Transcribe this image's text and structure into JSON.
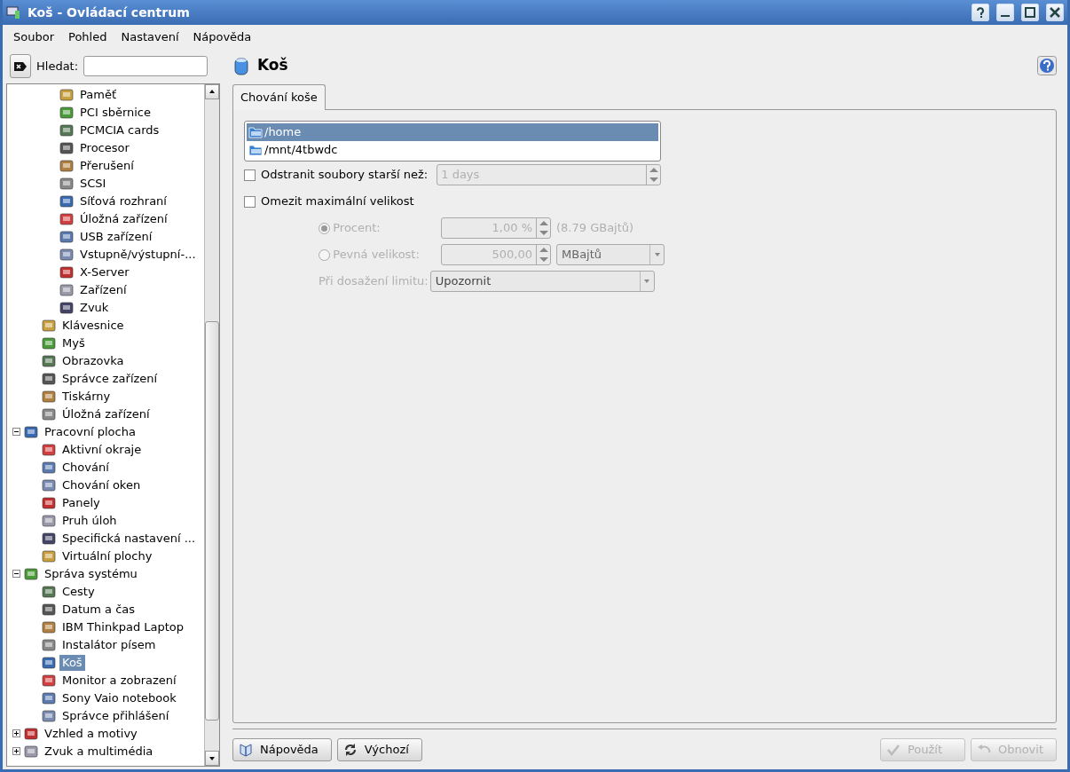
{
  "window": {
    "title": "Koš - Ovládací centrum"
  },
  "menu": [
    "Soubor",
    "Pohled",
    "Nastavení",
    "Nápověda"
  ],
  "search": {
    "label": "Hledat:"
  },
  "tree": [
    {
      "children": [
        {
          "children": [
            {
              "label": "Paměť",
              "selected": false
            },
            {
              "label": "PCI sběrnice",
              "selected": false
            },
            {
              "label": "PCMCIA cards",
              "selected": false
            },
            {
              "label": "Procesor",
              "selected": false
            },
            {
              "label": "Přerušení",
              "selected": false
            },
            {
              "label": "SCSI",
              "selected": false
            },
            {
              "label": "Síťová rozhraní",
              "selected": false
            },
            {
              "label": "Úložná zařízení",
              "selected": false
            },
            {
              "label": "USB zařízení",
              "selected": false
            },
            {
              "label": "Vstupně/výstupní-...",
              "selected": false
            },
            {
              "label": "X-Server",
              "selected": false
            },
            {
              "label": "Zařízení",
              "selected": false
            },
            {
              "label": "Zvuk",
              "selected": false
            }
          ]
        },
        {
          "label": "Klávesnice",
          "selected": false
        },
        {
          "label": "Myš",
          "selected": false
        },
        {
          "label": "Obrazovka",
          "selected": false
        },
        {
          "label": "Správce zařízení",
          "selected": false
        },
        {
          "label": "Tiskárny",
          "selected": false
        },
        {
          "label": "Úložná zařízení",
          "selected": false
        }
      ]
    },
    {
      "label": "Pracovní plocha",
      "selected": false,
      "expanded": true,
      "children": [
        {
          "label": "Aktivní okraje",
          "selected": false
        },
        {
          "label": "Chování",
          "selected": false
        },
        {
          "label": "Chování oken",
          "selected": false
        },
        {
          "label": "Panely",
          "selected": false
        },
        {
          "label": "Pruh úloh",
          "selected": false
        },
        {
          "label": "Specifická nastavení ...",
          "selected": false
        },
        {
          "label": "Virtuální plochy",
          "selected": false
        }
      ]
    },
    {
      "label": "Správa systému",
      "selected": false,
      "expanded": true,
      "children": [
        {
          "label": "Cesty",
          "selected": false
        },
        {
          "label": "Datum a čas",
          "selected": false
        },
        {
          "label": "IBM Thinkpad Laptop",
          "selected": false
        },
        {
          "label": "Instalátor písem",
          "selected": false
        },
        {
          "label": "Koš",
          "selected": true
        },
        {
          "label": "Monitor a zobrazení",
          "selected": false
        },
        {
          "label": "Sony Vaio notebook",
          "selected": false
        },
        {
          "label": "Správce přihlášení",
          "selected": false
        }
      ]
    },
    {
      "label": "Vzhled a motivy",
      "selected": false,
      "expanded": false
    },
    {
      "label": "Zvuk a multimédia",
      "selected": false,
      "expanded": false
    }
  ],
  "page": {
    "title": "Koš",
    "tabs": [
      {
        "label": "Chování koše",
        "selected": true
      }
    ],
    "folders": [
      {
        "label": "/home",
        "selected": true
      },
      {
        "label": "/mnt/4tbwdc",
        "selected": false
      }
    ],
    "delete_old": {
      "label": "Odstranit soubory starší než:",
      "checked": false,
      "value": "1 days",
      "disabled": true
    },
    "limit_size": {
      "label": "Omezit maximální velikost",
      "checked": false
    },
    "percent": {
      "label": "Procent:",
      "selected": true,
      "disabled": true,
      "value": "1,00 %",
      "note": "(8.79 GBajtů)"
    },
    "fixed": {
      "label": "Pevná velikost:",
      "selected": false,
      "disabled": true,
      "value": "500,00",
      "unit": "MBajtů"
    },
    "on_limit": {
      "label": "Při dosažení limitu:",
      "value": "Upozornit",
      "disabled": true
    }
  },
  "buttons_left": [
    {
      "label": "Nápověda",
      "disabled": false
    },
    {
      "label": "Výchozí",
      "disabled": false
    }
  ],
  "buttons_right": [
    {
      "label": "Použít",
      "disabled": true
    },
    {
      "label": "Obnovit",
      "disabled": true
    }
  ]
}
